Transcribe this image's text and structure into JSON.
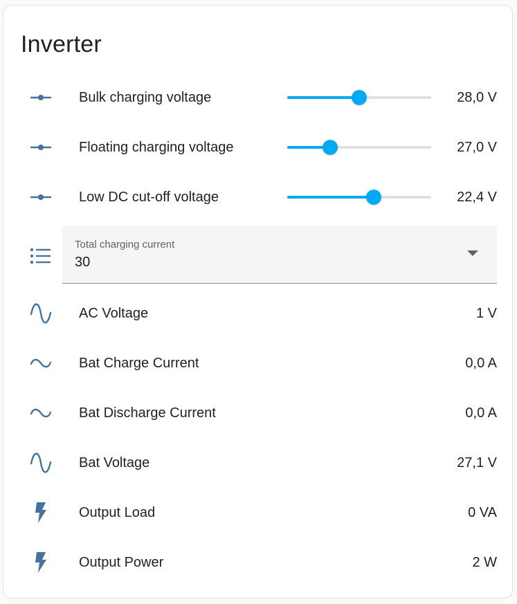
{
  "card": {
    "title": "Inverter"
  },
  "accent_color": "#03a9f4",
  "icon_color": "#44739e",
  "sliders": [
    {
      "label": "Bulk charging voltage",
      "value": "28,0 V",
      "icon": "slider-icon",
      "level_percent": 50
    },
    {
      "label": "Floating charging voltage",
      "value": "27,0 V",
      "icon": "slider-icon",
      "level_percent": 30
    },
    {
      "label": "Low DC cut-off voltage",
      "value": "22,4 V",
      "icon": "slider-icon",
      "level_percent": 60
    }
  ],
  "select": {
    "label": "Total charging current",
    "value": "30",
    "icon": "format-list-bulleted-icon"
  },
  "sensors": [
    {
      "label": "AC Voltage",
      "value": "1 V",
      "icon": "sine-wave-icon"
    },
    {
      "label": "Bat Charge Current",
      "value": "0,0 A",
      "icon": "current-ac-icon"
    },
    {
      "label": "Bat Discharge Current",
      "value": "0,0 A",
      "icon": "current-ac-icon"
    },
    {
      "label": "Bat Voltage",
      "value": "27,1 V",
      "icon": "sine-wave-icon"
    },
    {
      "label": "Output Load",
      "value": "0 VA",
      "icon": "flash-icon"
    },
    {
      "label": "Output Power",
      "value": "2 W",
      "icon": "flash-icon"
    }
  ]
}
